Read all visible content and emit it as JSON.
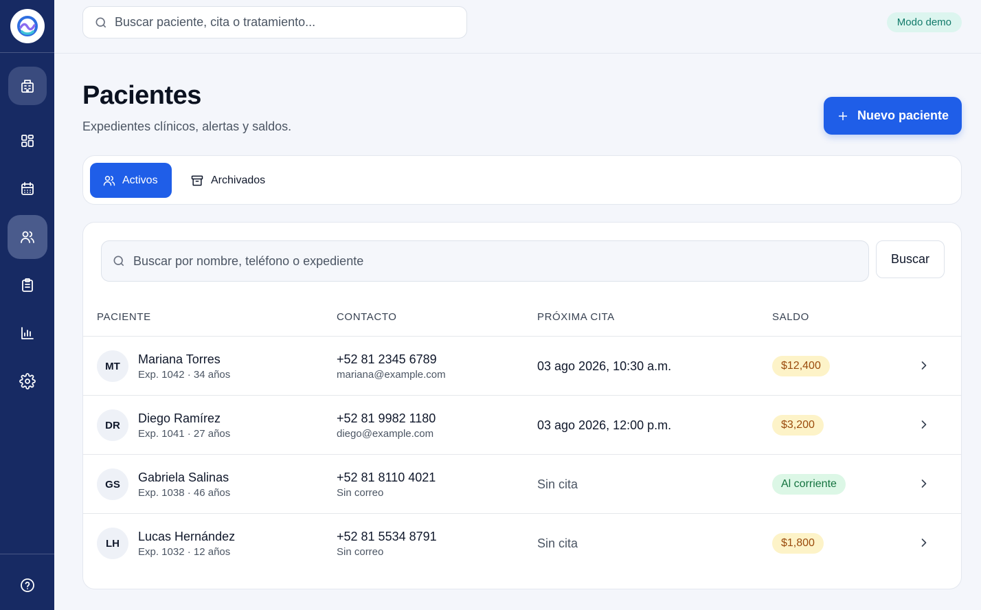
{
  "topbar": {
    "search_placeholder": "Buscar paciente, cita o tratamiento...",
    "demo_badge": "Modo demo"
  },
  "sidebar": {
    "items": [
      {
        "name": "building",
        "icon": "building-icon"
      },
      {
        "name": "dashboard",
        "icon": "grid-icon"
      },
      {
        "name": "calendar",
        "icon": "calendar-icon"
      },
      {
        "name": "patients",
        "icon": "users-icon",
        "active": true
      },
      {
        "name": "records",
        "icon": "clipboard-icon"
      },
      {
        "name": "reports",
        "icon": "bar-chart-icon"
      },
      {
        "name": "settings",
        "icon": "gear-icon"
      },
      {
        "name": "help",
        "icon": "help-circle-icon"
      }
    ]
  },
  "header": {
    "title": "Pacientes",
    "subtitle": "Expedientes clínicos, alertas y saldos.",
    "new_button": "Nuevo paciente"
  },
  "tabs": [
    {
      "label": "Activos",
      "icon": "users-icon",
      "active": true
    },
    {
      "label": "Archivados",
      "icon": "archive-icon",
      "active": false
    }
  ],
  "list": {
    "search_placeholder": "Buscar por nombre, teléfono o expediente",
    "search_button": "Buscar",
    "columns": [
      "PACIENTE",
      "CONTACTO",
      "PRÓXIMA CITA",
      "SALDO"
    ],
    "rows": [
      {
        "initials": "MT",
        "name": "Mariana Torres",
        "meta": "Exp. 1042 · 34 años",
        "phone": "+52 81 2345 6789",
        "email": "mariana@example.com",
        "appointment": "03 ago 2026, 10:30 a.m.",
        "balance": "$12,400",
        "balance_status": "debt"
      },
      {
        "initials": "DR",
        "name": "Diego Ramírez",
        "meta": "Exp. 1041 · 27 años",
        "phone": "+52 81 9982 1180",
        "email": "diego@example.com",
        "appointment": "03 ago 2026, 12:00 p.m.",
        "balance": "$3,200",
        "balance_status": "debt"
      },
      {
        "initials": "GS",
        "name": "Gabriela Salinas",
        "meta": "Exp. 1038 · 46 años",
        "phone": "+52 81 8110 4021",
        "email": "Sin correo",
        "appointment": "Sin cita",
        "balance": "Al corriente",
        "balance_status": "ok"
      },
      {
        "initials": "LH",
        "name": "Lucas Hernández",
        "meta": "Exp. 1032 · 12 años",
        "phone": "+52 81 5534 8791",
        "email": "Sin correo",
        "appointment": "Sin cita",
        "balance": "$1,800",
        "balance_status": "debt"
      }
    ]
  },
  "colors": {
    "sidebar_bg": "#172a63",
    "accent": "#1f5ee8",
    "debt_badge_bg": "#fdf3c8",
    "ok_badge_bg": "#dcf7e6",
    "demo_badge_bg": "#dcf5ef"
  }
}
